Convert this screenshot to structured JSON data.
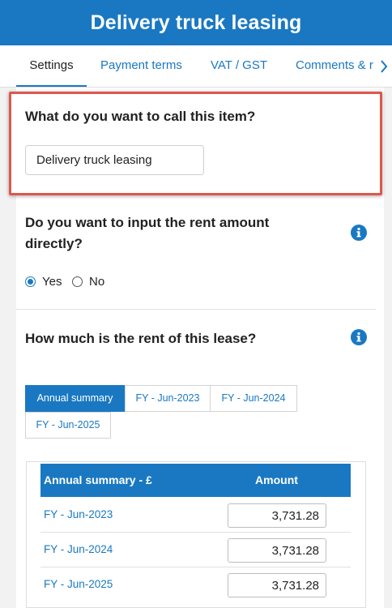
{
  "header": {
    "title": "Delivery truck leasing"
  },
  "tabs": [
    {
      "label": "Settings"
    },
    {
      "label": "Payment terms"
    },
    {
      "label": "VAT / GST"
    },
    {
      "label": "Comments & r"
    }
  ],
  "item_name": {
    "question": "What do you want to call this item?",
    "value": "Delivery truck leasing"
  },
  "rent_direct": {
    "question_line1": "Do you want to input the rent amount",
    "question_line2": "directly?",
    "options": [
      {
        "label": "Yes",
        "checked": true
      },
      {
        "label": "No",
        "checked": false
      }
    ]
  },
  "rent_amount": {
    "question": "How much is the rent of this lease?",
    "period_tabs": [
      {
        "label": "Annual summary",
        "active": true
      },
      {
        "label": "FY - Jun-2023",
        "active": false
      },
      {
        "label": "FY - Jun-2024",
        "active": false
      },
      {
        "label": "FY - Jun-2025",
        "active": false
      }
    ],
    "table": {
      "headers": [
        "Annual summary - £",
        "Amount"
      ],
      "rows": [
        {
          "label": "FY - Jun-2023",
          "amount": "3,731.28"
        },
        {
          "label": "FY - Jun-2024",
          "amount": "3,731.28"
        },
        {
          "label": "FY - Jun-2025",
          "amount": "3,731.28"
        }
      ]
    }
  },
  "colors": {
    "accent": "#1a78c2",
    "highlight_border": "#e0574c"
  },
  "icons": [
    "chevron-right-icon",
    "info-icon"
  ]
}
